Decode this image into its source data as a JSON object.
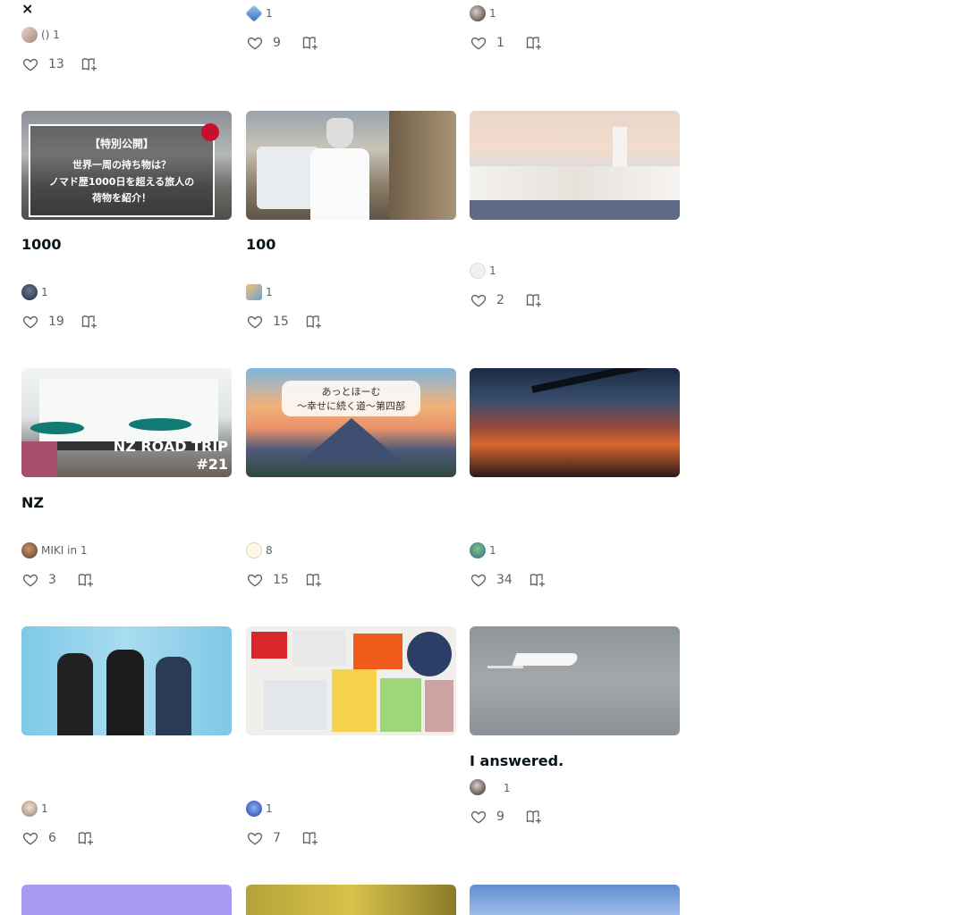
{
  "cards": [
    {
      "title": "×",
      "author": " () 1",
      "likes": "13"
    },
    {
      "title": "",
      "author": " 1",
      "likes": "9"
    },
    {
      "title": "",
      "author": " 1",
      "likes": "1"
    },
    {
      "title": "1000",
      "author": "  1",
      "likes": "19",
      "thumb_text": [
        "【特別公開】",
        "世界一周の持ち物は？",
        "ノマド歴1000日を超える旅人の",
        "荷物を紹介！"
      ]
    },
    {
      "title": "100",
      "author": " 1",
      "likes": "15"
    },
    {
      "title": "",
      "author": " 1",
      "likes": "2"
    },
    {
      "title": "NZ",
      "author": "MIKI in  1",
      "likes": "3",
      "thumb_text": [
        "NZ ROAD TRIP",
        "#21"
      ]
    },
    {
      "title": "　",
      "author": " 8",
      "likes": "15",
      "thumb_text": [
        "あっとほーむ",
        "～幸せに続く道～第四部"
      ]
    },
    {
      "title": "",
      "author": " 1",
      "likes": "34"
    },
    {
      "title": "",
      "author": " 1",
      "likes": "6"
    },
    {
      "title": "",
      "author": " 1",
      "likes": "7"
    },
    {
      "title": "I answered.",
      "author": "　 1",
      "likes": "9"
    }
  ],
  "colors": {
    "text": "#08131a",
    "meta": "#5a6266"
  },
  "icons": {
    "like": "heart-outline-icon",
    "save": "magazine-add-icon"
  }
}
